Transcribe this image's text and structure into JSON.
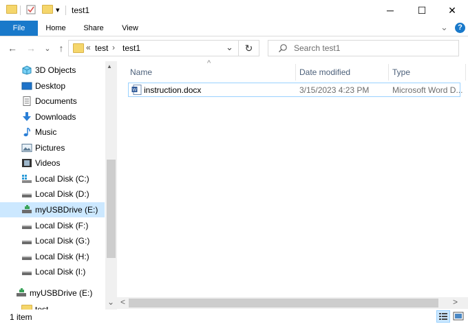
{
  "window": {
    "title": "test1",
    "minimize_glyph": "─",
    "maximize_glyph": "☐",
    "close_glyph": "✕",
    "qa_dropdown_glyph": "▾"
  },
  "ribbon": {
    "tabs": [
      "File",
      "Home",
      "Share",
      "View"
    ],
    "collapse_glyph": "⌄",
    "help_glyph": "?",
    "accent": "#1979ca"
  },
  "nav": {
    "back_glyph": "←",
    "forward_glyph": "→",
    "recent_glyph": "⌄",
    "up_glyph": "↑",
    "breadcrumb_overflow": "«",
    "breadcrumb": [
      "test",
      "test1"
    ],
    "breadcrumb_sep": "›",
    "address_dropdown_glyph": "⌄",
    "refresh_glyph": "↻",
    "search_placeholder": "Search test1"
  },
  "sidebar": {
    "items": [
      {
        "label": "3D Objects",
        "icon": "3d-objects-icon"
      },
      {
        "label": "Desktop",
        "icon": "desktop-icon"
      },
      {
        "label": "Documents",
        "icon": "documents-icon"
      },
      {
        "label": "Downloads",
        "icon": "downloads-icon"
      },
      {
        "label": "Music",
        "icon": "music-icon"
      },
      {
        "label": "Pictures",
        "icon": "pictures-icon"
      },
      {
        "label": "Videos",
        "icon": "videos-icon"
      },
      {
        "label": "Local Disk (C:)",
        "icon": "windows-drive-icon"
      },
      {
        "label": "Local Disk (D:)",
        "icon": "drive-icon"
      },
      {
        "label": "myUSBDrive (E:)",
        "icon": "usb-drive-icon",
        "selected": true
      },
      {
        "label": "Local Disk (F:)",
        "icon": "drive-icon"
      },
      {
        "label": "Local Disk (G:)",
        "icon": "drive-icon"
      },
      {
        "label": "Local Disk (H:)",
        "icon": "drive-icon"
      },
      {
        "label": "Local Disk (I:)",
        "icon": "drive-icon"
      }
    ],
    "usb_root": {
      "label": "myUSBDrive (E:)",
      "icon": "usb-drive-icon"
    },
    "partial_item": {
      "label": "test",
      "icon": "folder-icon"
    },
    "scroll_up_glyph": "▲",
    "scroll_down_glyph": "⌄"
  },
  "content": {
    "sort_glyph": "^",
    "columns": [
      "Name",
      "Date modified",
      "Type"
    ],
    "files": [
      {
        "name": "instruction.docx",
        "date_modified": "3/15/2023 4:23 PM",
        "type": "Microsoft Word D..."
      }
    ],
    "hscroll_left_glyph": "<",
    "hscroll_right_glyph": ">"
  },
  "status": {
    "item_count": "1 item"
  }
}
